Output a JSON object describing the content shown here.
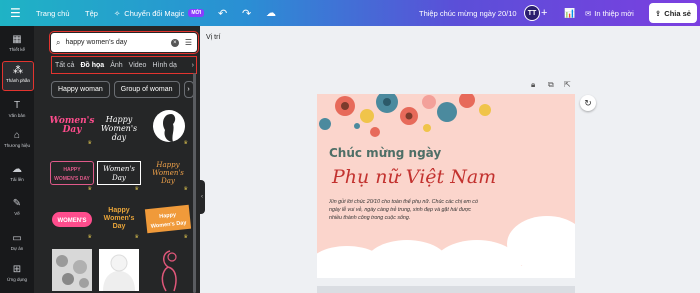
{
  "topbar": {
    "menu_icon": "hamburger-icon",
    "home": "Trang chủ",
    "file": "Tệp",
    "magic": "Chuyển đổi Magic",
    "magic_badge": "MỚI",
    "title": "Thiệp chúc mừng ngày 20/10",
    "avatar": "TT",
    "print": "In thiệp mời",
    "share": "Chia sẻ"
  },
  "rail": {
    "items": [
      {
        "label": "Thiết kế",
        "icon": "layout-icon"
      },
      {
        "label": "Thành phần",
        "icon": "shapes-icon"
      },
      {
        "label": "Văn bản",
        "icon": "text-icon"
      },
      {
        "label": "Thương hiệu",
        "icon": "brand-icon"
      },
      {
        "label": "Tải lên",
        "icon": "cloud-upload-icon"
      },
      {
        "label": "Vẽ",
        "icon": "pen-icon"
      },
      {
        "label": "Dự án",
        "icon": "folder-icon"
      },
      {
        "label": "Ứng dụng",
        "icon": "apps-icon"
      }
    ]
  },
  "panel": {
    "search_value": "happy women's day",
    "tabs": [
      "Tất cả",
      "Đồ họa",
      "Ảnh",
      "Video",
      "Hình dạ"
    ],
    "active_tab": "Đồ họa",
    "chips": [
      "Happy woman",
      "Group of woman"
    ],
    "graphics": [
      {
        "text": "Women's Day",
        "color": "#ff4d8d"
      },
      {
        "text": "Happy Women's day",
        "color": "#ffffff"
      },
      {
        "text": "",
        "color": "#ffffff"
      },
      {
        "text": "HAPPY WOMEN'S DAY",
        "color": "#e05a8a"
      },
      {
        "text": "Women's Day",
        "color": "#ffffff"
      },
      {
        "text": "Happy Women's Day",
        "color": "#f0a24a"
      },
      {
        "text": "WOMEN'S",
        "color": "#ff4d8d"
      },
      {
        "text": "Happy Women's Day",
        "color": "#e8a43a"
      },
      {
        "text": "Happy Women's Day",
        "color": "#f09a3a"
      }
    ]
  },
  "canvas": {
    "position_label": "Vị trí",
    "heading": "Chúc mừng ngày",
    "script": "Phụ nữ Việt Nam",
    "body": "Xin gửi lời chúc 20/10 cho toàn thể phụ nữ. Chúc các chị em có ngày lễ vui vẻ, ngày càng trẻ trung, xinh đẹp và gặt hái được nhiều thành công trong cuộc sống."
  },
  "colors": {
    "accent_red": "#e3342f",
    "card_bg": "#fbd5cc",
    "heading": "#4e6f67",
    "script": "#c3322f"
  }
}
